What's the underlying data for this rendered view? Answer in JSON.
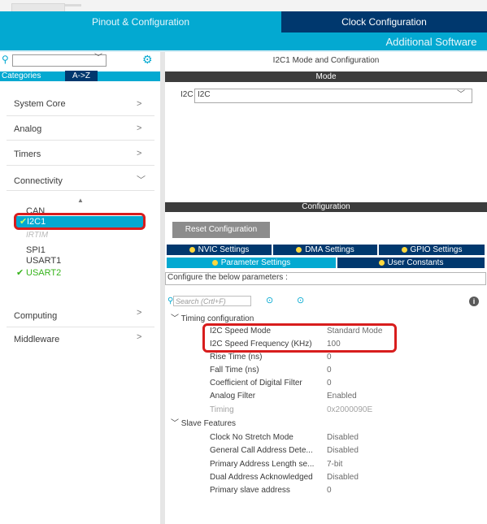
{
  "header": {
    "tabs": [
      {
        "label": "Pinout & Configuration",
        "active": true
      },
      {
        "label": "Clock Configuration",
        "active": false
      }
    ],
    "secondary_tab": "Additional Software"
  },
  "sidebar": {
    "search_icon": "search-icon",
    "settings_icon": "gear-icon",
    "filter_tabs": [
      "Categories",
      "A->Z"
    ],
    "categories": [
      {
        "label": "System Core",
        "expanded": false
      },
      {
        "label": "Analog",
        "expanded": false
      },
      {
        "label": "Timers",
        "expanded": false
      },
      {
        "label": "Connectivity",
        "expanded": true
      },
      {
        "label": "Computing",
        "expanded": false
      },
      {
        "label": "Middleware",
        "expanded": false
      }
    ],
    "connectivity_items": [
      {
        "label": "CAN",
        "state": "normal"
      },
      {
        "label": "I2C1",
        "state": "selected-enabled"
      },
      {
        "label": "IRTIM",
        "state": "disabled"
      },
      {
        "label": "SPI1",
        "state": "normal"
      },
      {
        "label": "USART1",
        "state": "normal"
      },
      {
        "label": "USART2",
        "state": "enabled"
      }
    ]
  },
  "main": {
    "title": "I2C1 Mode and Configuration",
    "mode": {
      "section_label": "Mode",
      "field_label": "I2C",
      "field_value": "I2C"
    },
    "configuration": {
      "section_label": "Configuration",
      "reset_button": "Reset Configuration",
      "tabs_row1": [
        "NVIC Settings",
        "DMA Settings",
        "GPIO Settings"
      ],
      "tabs_row2": [
        "Parameter Settings",
        "User Constants"
      ],
      "active_tab": "Parameter Settings",
      "instruction": "Configure the below parameters :",
      "search_placeholder": "Search (Crtl+F)",
      "groups": [
        {
          "name": "Timing configuration",
          "params": [
            {
              "name": "I2C Speed Mode",
              "value": "Standard Mode",
              "grey": false
            },
            {
              "name": "I2C Speed Frequency (KHz)",
              "value": "100",
              "grey": false
            },
            {
              "name": "Rise Time (ns)",
              "value": "0",
              "grey": false
            },
            {
              "name": "Fall Time (ns)",
              "value": "0",
              "grey": false
            },
            {
              "name": "Coefficient of Digital Filter",
              "value": "0",
              "grey": false
            },
            {
              "name": "Analog Filter",
              "value": "Enabled",
              "grey": false
            },
            {
              "name": "Timing",
              "value": "0x2000090E",
              "grey": true
            }
          ]
        },
        {
          "name": "Slave Features",
          "params": [
            {
              "name": "Clock No Stretch Mode",
              "value": "Disabled",
              "grey": false
            },
            {
              "name": "General Call Address Dete...",
              "value": "Disabled",
              "grey": false
            },
            {
              "name": "Primary Address Length se...",
              "value": "7-bit",
              "grey": false
            },
            {
              "name": "Dual Address Acknowledged",
              "value": "Disabled",
              "grey": false
            },
            {
              "name": "Primary slave address",
              "value": "0",
              "grey": false
            }
          ]
        }
      ]
    }
  },
  "colors": {
    "accent_blue": "#03a9d1",
    "dark_navy": "#00386e",
    "section_bar": "#3c3c3c",
    "enabled_green": "#36b31b",
    "status_dot": "#ffd83d",
    "highlight_red": "#d81d1d"
  }
}
